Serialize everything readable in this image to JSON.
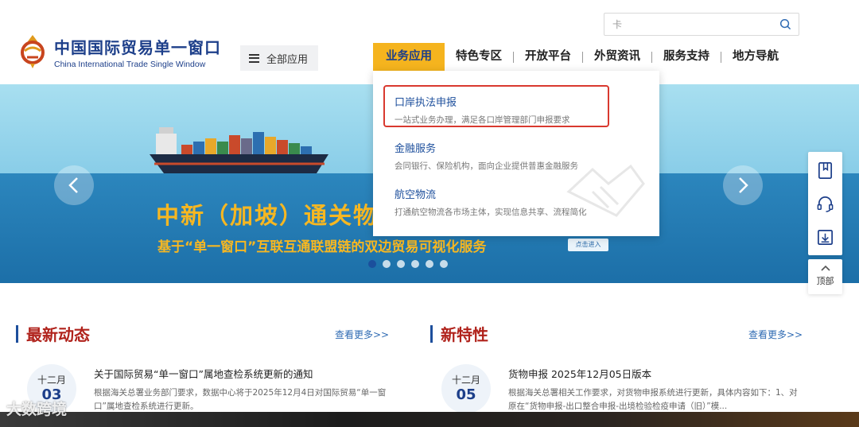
{
  "header": {
    "logo_cn": "中国国际贸易单一窗口",
    "logo_en": "China International Trade Single Window",
    "all_apps_label": "全部应用",
    "search": {
      "value": "卡"
    },
    "nav": [
      "业务应用",
      "特色专区",
      "开放平台",
      "外贸资讯",
      "服务支持",
      "地方导航"
    ],
    "active_nav": "业务应用"
  },
  "dropdown": {
    "items": [
      {
        "title": "口岸执法申报",
        "desc": "一站式业务办理，满足各口岸管理部门申报要求",
        "highlighted": true
      },
      {
        "title": "金融服务",
        "desc": "会同银行、保险机构，面向企业提供普惠金融服务"
      },
      {
        "title": "航空物流",
        "desc": "打通航空物流各市场主体，实现信息共享、流程简化"
      }
    ]
  },
  "banner": {
    "title": "中新（加坡）通关物流",
    "subtitle": "基于“单一窗口”互联互通联盟链的双边贸易可视化服务",
    "button": "点击进入",
    "slides_count": 6,
    "active_slide": 1
  },
  "side_tools": {
    "top_label": "顶部",
    "icons": [
      "book-icon",
      "headset-icon",
      "download-icon"
    ]
  },
  "sections": {
    "latest": {
      "title": "最新动态",
      "more": "查看更多>>",
      "month": "十二月",
      "day": "03",
      "news_title": "关于国际贸易“单一窗口”属地查检系统更新的通知",
      "news_desc": "根据海关总署业务部门要求，数据中心将于2025年12月4日对国际贸易“单一窗口”属地查检系统进行更新。"
    },
    "features": {
      "title": "新特性",
      "more": "查看更多>>",
      "month": "十二月",
      "day": "05",
      "news_title": "货物申报 2025年12月05日版本",
      "news_desc": "根据海关总署相关工作要求，对货物申报系统进行更新，具体内容如下：1、对原在“货物申报-出口整合申报-出境检验检疫申请（旧）”模..."
    }
  },
  "watermark": "大数跨境",
  "colors": {
    "brand": "#1d3f8a",
    "accent": "#f5b41e",
    "title_red": "#b0221b",
    "highlight": "#d9392f"
  }
}
